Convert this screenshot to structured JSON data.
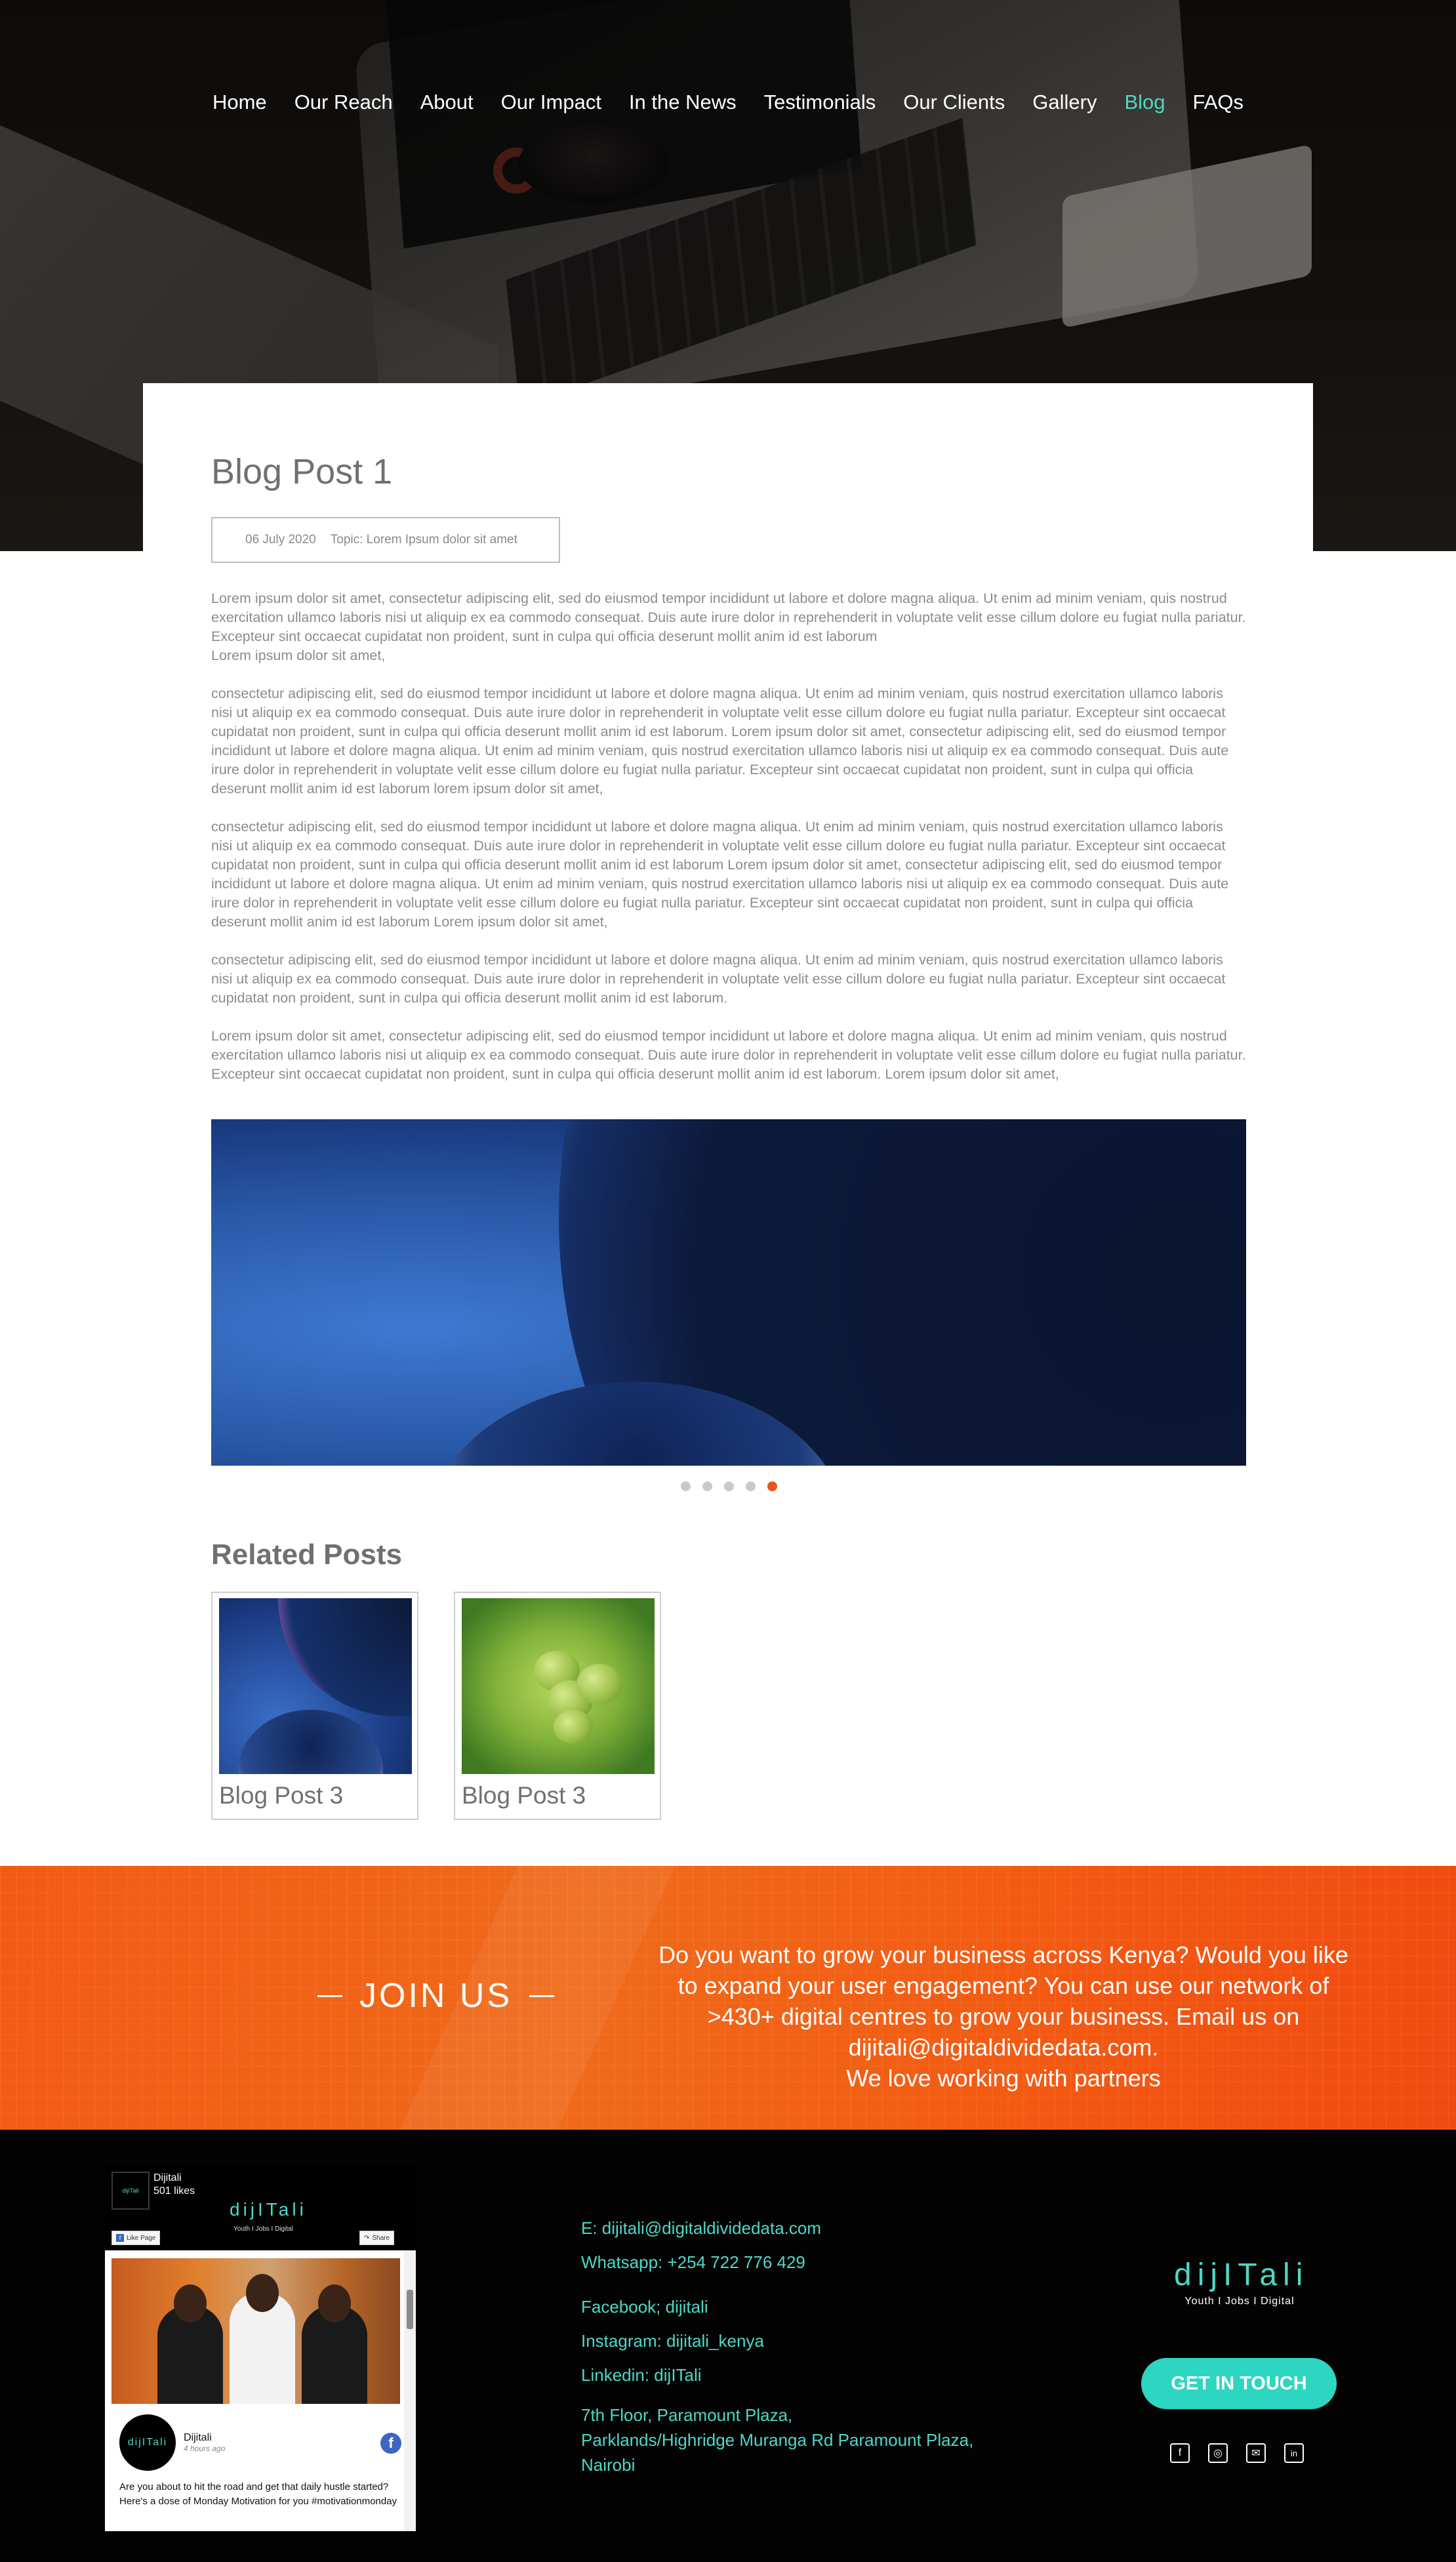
{
  "nav": {
    "items": [
      "Home",
      "Our Reach",
      "About",
      "Our Impact",
      "In the News",
      "Testimonials",
      "Our Clients",
      "Gallery",
      "Blog",
      "FAQs"
    ],
    "active": "Blog"
  },
  "post": {
    "title": "Blog Post 1",
    "date": "06 July 2020",
    "topic": "Topic: Lorem Ipsum dolor sit amet",
    "paragraphs": [
      "Lorem ipsum dolor sit amet, consectetur adipiscing elit, sed do eiusmod tempor incididunt ut labore et dolore magna aliqua. Ut enim ad minim veniam, quis nostrud exercitation ullamco laboris nisi ut aliquip ex ea commodo consequat. Duis aute irure dolor in reprehenderit in voluptate velit esse cillum dolore eu fugiat nulla pariatur. Excepteur sint occaecat cupidatat non proident, sunt in culpa qui officia deserunt mollit anim id est laborum",
      "Lorem ipsum dolor sit amet,",
      "consectetur adipiscing elit, sed do eiusmod tempor incididunt ut labore et dolore magna aliqua. Ut enim ad minim veniam, quis nostrud exercitation ullamco laboris nisi ut aliquip ex ea commodo consequat. Duis aute irure dolor in reprehenderit in voluptate velit esse cillum dolore eu fugiat nulla pariatur. Excepteur sint occaecat cupidatat non proident, sunt in culpa qui officia deserunt mollit anim id est laborum. Lorem ipsum dolor sit amet, consectetur adipiscing elit, sed do eiusmod tempor incididunt ut labore et dolore magna aliqua. Ut enim ad minim veniam, quis nostrud exercitation ullamco laboris nisi ut aliquip ex ea commodo consequat. Duis aute irure dolor in reprehenderit in voluptate velit esse cillum dolore eu fugiat nulla pariatur. Excepteur sint occaecat cupidatat non proident, sunt in culpa qui officia deserunt mollit anim id est laborum lorem ipsum dolor sit amet,",
      "consectetur adipiscing elit, sed do eiusmod tempor incididunt ut labore et dolore magna aliqua. Ut enim ad minim veniam, quis nostrud exercitation ullamco laboris nisi ut aliquip ex ea commodo consequat. Duis aute irure dolor in reprehenderit in voluptate velit esse cillum dolore eu fugiat nulla pariatur. Excepteur sint occaecat cupidatat non proident, sunt in culpa qui officia deserunt mollit anim id est laborum Lorem ipsum dolor sit amet, consectetur adipiscing elit, sed do eiusmod tempor incididunt ut labore et dolore magna aliqua. Ut enim ad minim veniam, quis nostrud exercitation ullamco laboris nisi ut aliquip ex ea commodo consequat. Duis aute irure dolor in reprehenderit in voluptate velit esse cillum dolore eu fugiat nulla pariatur. Excepteur sint occaecat cupidatat non proident, sunt in culpa qui officia deserunt mollit anim id est laborum Lorem ipsum dolor sit amet,",
      "consectetur adipiscing elit, sed do eiusmod tempor incididunt ut labore et dolore magna aliqua. Ut enim ad minim veniam, quis nostrud exercitation ullamco laboris nisi ut aliquip ex ea commodo consequat. Duis aute irure dolor in reprehenderit in voluptate velit esse cillum dolore eu fugiat nulla pariatur. Excepteur sint occaecat cupidatat non proident, sunt in culpa qui officia deserunt mollit anim id est laborum.",
      "Lorem ipsum dolor sit amet, consectetur adipiscing elit, sed do eiusmod tempor incididunt ut labore et dolore magna aliqua. Ut enim ad minim veniam, quis nostrud exercitation ullamco laboris nisi ut aliquip ex ea commodo consequat. Duis aute irure dolor in reprehenderit in voluptate velit esse cillum dolore eu fugiat nulla pariatur. Excepteur sint occaecat cupidatat non proident, sunt in culpa qui officia deserunt mollit anim id est laborum. Lorem ipsum dolor sit amet,"
    ]
  },
  "slider": {
    "slide_count": 5,
    "active_index": 4
  },
  "related": {
    "title": "Related Posts",
    "posts": [
      {
        "label": "Blog Post 3"
      },
      {
        "label": "Blog Post 3"
      }
    ]
  },
  "join": {
    "title": "JOIN US",
    "lines": [
      "Do you want to grow your business across Kenya? Would you like",
      "to expand your user engagement? You can use our network of",
      ">430+ digital centres to grow your business. Email us on",
      "dijitali@digitaldividedata.com.",
      "We love working with partners"
    ]
  },
  "facebook": {
    "page_name": "Dijitali",
    "likes": "501 likes",
    "logo": "dijITali",
    "logo_sub": "Youth I Jobs I Digital",
    "like_button": "Like Page",
    "share_button": "Share",
    "post_author": "Dijitali",
    "post_time": "4 hours ago",
    "post_text": "Are you about to hit the road and get that daily hustle started? Here's a dose of Monday Motivation for you #motivationmonday"
  },
  "contact": {
    "email": "E: dijitali@digitaldividedata.com",
    "whatsapp": "Whatsapp: +254 722 776 429",
    "facebook": "Facebook; dijitali",
    "instagram": "Instagram: dijitali_kenya",
    "linkedin": "Linkedin: dijITali",
    "address_1": "7th Floor, Paramount Plaza,",
    "address_2": "Parklands/Highridge Muranga Rd Paramount Plaza,",
    "address_3": "Nairobi"
  },
  "brand": {
    "logo": "dijITali",
    "tagline": "Youth I Jobs I Digital",
    "cta": "GET IN TOUCH",
    "social_icons": [
      "facebook-icon",
      "instagram-icon",
      "email-icon",
      "linkedin-icon"
    ]
  },
  "colors": {
    "accent": "#4ed8c6",
    "orange": "#f25a14",
    "active_dot": "#e8561c"
  }
}
